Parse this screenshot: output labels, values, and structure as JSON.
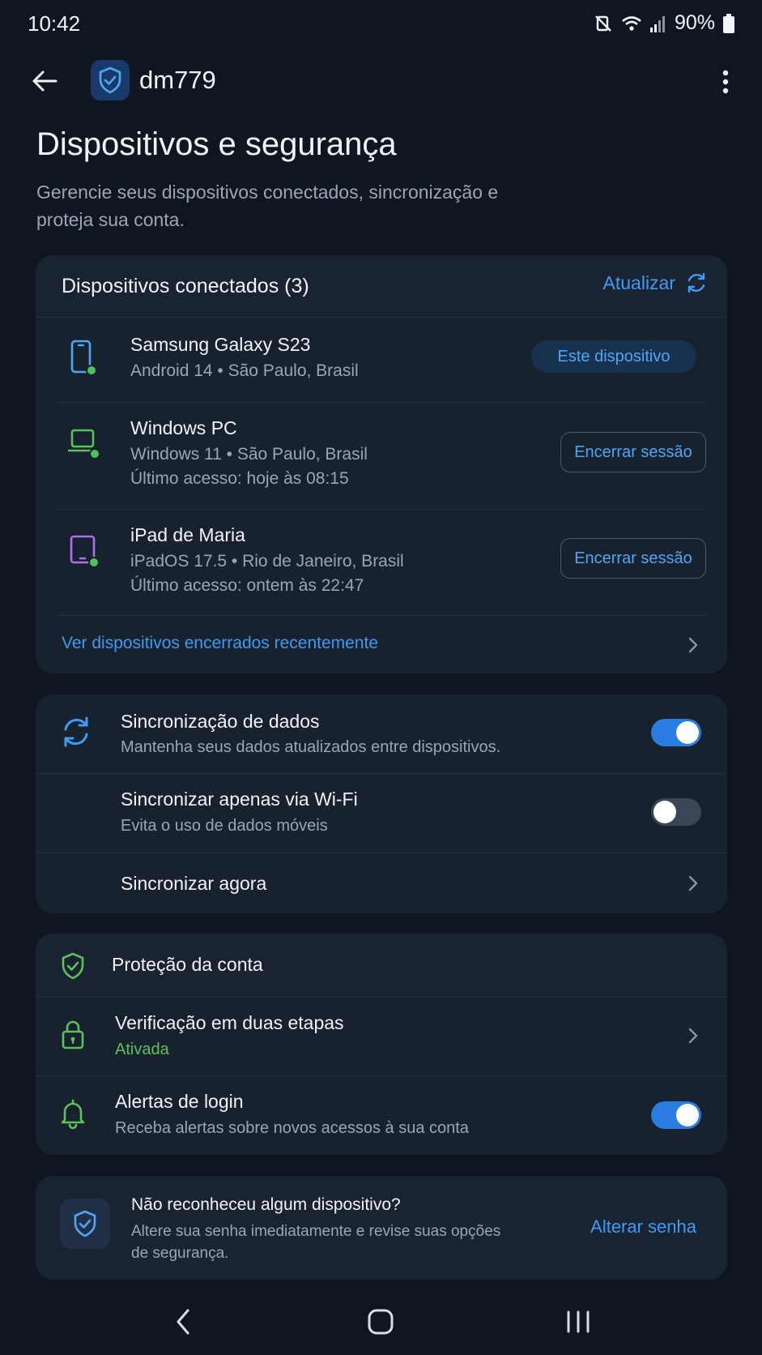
{
  "status_bar": {
    "time": "10:42",
    "battery": "90%"
  },
  "app_bar": {
    "account_name": "dm779"
  },
  "page": {
    "title": "Dispositivos e segurança",
    "subtitle": "Gerencie seus dispositivos conectados, sincronização e proteja sua conta."
  },
  "devices_card": {
    "title": "Dispositivos conectados (3)",
    "refresh_label": "Atualizar",
    "devices": [
      {
        "name": "Samsung Galaxy S23",
        "meta": "Android 14 • São Paulo, Brasil",
        "badge": "Este dispositivo",
        "icon": "smartphone-icon",
        "color": "#4fa6f7"
      },
      {
        "name": "Windows PC",
        "meta": "Windows 11 • São Paulo, Brasil",
        "last_access": "Último acesso: hoje às 08:15",
        "action": "Encerrar sessão",
        "icon": "laptop-icon",
        "color": "#5cc15a"
      },
      {
        "name": "iPad de Maria",
        "meta": "iPadOS 17.5 • Rio de Janeiro, Brasil",
        "last_access": "Último acesso: ontem às 22:47",
        "action": "Encerrar sessão",
        "icon": "tablet-icon",
        "color": "#b06ef0"
      }
    ],
    "recent_link": "Ver dispositivos encerrados recentemente"
  },
  "sync_card": {
    "data_sync": {
      "title": "Sincronização de dados",
      "subtitle": "Mantenha seus dados atualizados entre dispositivos.",
      "enabled": true
    },
    "wifi_only": {
      "title": "Sincronizar apenas via Wi-Fi",
      "subtitle": "Evita o uso de dados móveis",
      "enabled": false
    },
    "sync_now": {
      "title": "Sincronizar agora"
    }
  },
  "protection_card": {
    "title": "Proteção da conta",
    "two_step": {
      "title": "Verificação em duas etapas",
      "status": "Ativada"
    },
    "login_alerts": {
      "title": "Alertas de login",
      "subtitle": "Receba alertas sobre novos acessos à sua conta",
      "enabled": true
    }
  },
  "alert_card": {
    "title": "Não reconheceu algum dispositivo?",
    "body": "Altere sua senha imediatamente e revise suas opções de segurança.",
    "action": "Alterar senha"
  },
  "colors": {
    "accent": "#3d9bf5",
    "success": "#5cc15a",
    "background": "#0e1621",
    "card": "#18212e"
  }
}
